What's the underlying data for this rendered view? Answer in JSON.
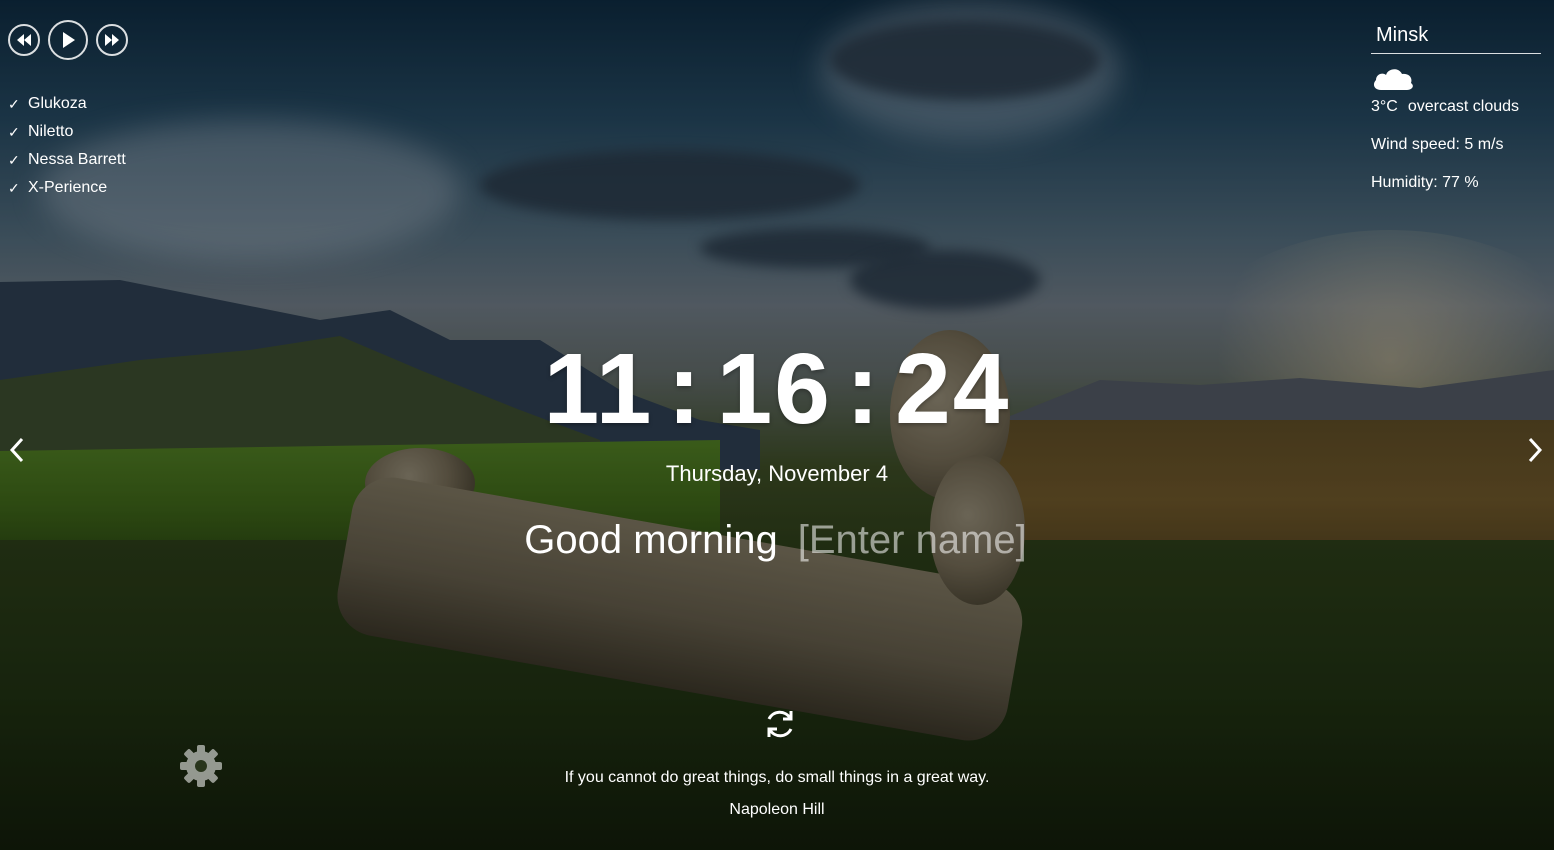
{
  "player": {
    "prev_icon": "rewind-icon",
    "play_icon": "play-icon",
    "next_icon": "fast-forward-icon",
    "playlist": [
      {
        "title": "Glukoza",
        "check": "✓"
      },
      {
        "title": "Niletto",
        "check": "✓"
      },
      {
        "title": "Nessa Barrett",
        "check": "✓"
      },
      {
        "title": "X-Perience",
        "check": "✓"
      }
    ]
  },
  "weather": {
    "city": "Minsk",
    "icon": "cloud-icon",
    "temperature": "3°C",
    "description": "overcast clouds",
    "wind": "Wind speed: 5 m/s",
    "humidity": "Humidity: 77 %"
  },
  "clock": {
    "hours": "11",
    "minutes": "16",
    "seconds": "24",
    "separator": ":"
  },
  "date": "Thursday, November 4",
  "greeting": {
    "text": "Good morning",
    "name_placeholder": "[Enter name]"
  },
  "quote": {
    "text": "If you cannot do great things, do small things in a great way.",
    "author": "Napoleon Hill",
    "refresh_icon": "refresh-icon"
  },
  "settings_icon": "gear-icon",
  "slider": {
    "prev_icon": "chevron-left-icon",
    "next_icon": "chevron-right-icon"
  }
}
